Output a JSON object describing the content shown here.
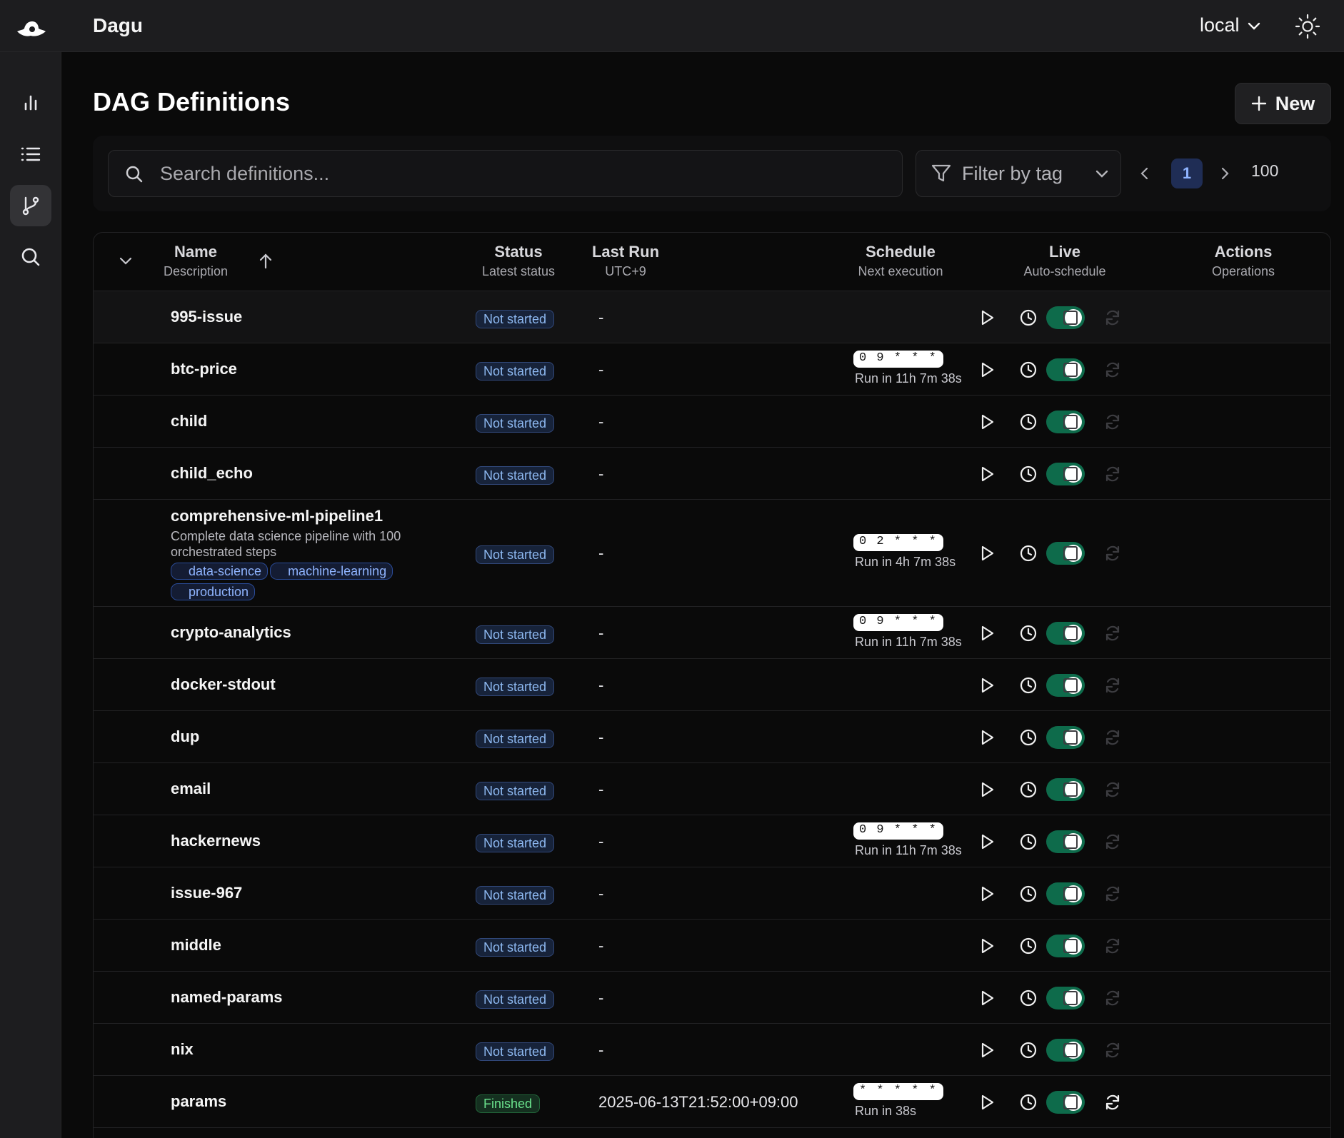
{
  "app": {
    "title": "Dagu",
    "environment": "local"
  },
  "sidebar": {
    "items": [
      {
        "icon": "bar-chart-icon"
      },
      {
        "icon": "list-icon"
      },
      {
        "icon": "git-branch-icon",
        "active": true
      },
      {
        "icon": "search-icon"
      }
    ]
  },
  "page": {
    "title": "DAG Definitions",
    "new_label": "New"
  },
  "filters": {
    "search_placeholder": "Search definitions...",
    "search_value": "",
    "tag_placeholder": "Filter by tag",
    "current_page": "1",
    "page_size": "100"
  },
  "table": {
    "columns": {
      "name": {
        "title": "Name",
        "subtitle": "Description"
      },
      "status": {
        "title": "Status",
        "subtitle": "Latest status"
      },
      "last_run": {
        "title": "Last Run",
        "subtitle": "UTC+9"
      },
      "schedule": {
        "title": "Schedule",
        "subtitle": "Next execution"
      },
      "live": {
        "title": "Live",
        "subtitle": "Auto-schedule"
      },
      "actions": {
        "title": "Actions",
        "subtitle": "Operations"
      }
    },
    "rows": [
      {
        "name": "995-issue",
        "status": "Not started",
        "last_run": "-",
        "live": true
      },
      {
        "name": "btc-price",
        "status": "Not started",
        "last_run": "-",
        "cron": "0 9 * * *",
        "next_run": "Run in 11h 7m 38s",
        "live": true
      },
      {
        "name": "child",
        "status": "Not started",
        "last_run": "-",
        "live": true
      },
      {
        "name": "child_echo",
        "status": "Not started",
        "last_run": "-",
        "live": true
      },
      {
        "name": "comprehensive-ml-pipeline1",
        "description": "Complete data science pipeline with 100 orchestrated steps",
        "tags": [
          "data-science",
          "machine-learning",
          "production"
        ],
        "status": "Not started",
        "last_run": "-",
        "cron": "0 2 * * *",
        "next_run": "Run in 4h 7m 38s",
        "live": true
      },
      {
        "name": "crypto-analytics",
        "status": "Not started",
        "last_run": "-",
        "cron": "0 9 * * *",
        "next_run": "Run in 11h 7m 38s",
        "live": true
      },
      {
        "name": "docker-stdout",
        "status": "Not started",
        "last_run": "-",
        "live": true
      },
      {
        "name": "dup",
        "status": "Not started",
        "last_run": "-",
        "live": true
      },
      {
        "name": "email",
        "status": "Not started",
        "last_run": "-",
        "live": true
      },
      {
        "name": "hackernews",
        "status": "Not started",
        "last_run": "-",
        "cron": "0 9 * * *",
        "next_run": "Run in 11h 7m 38s",
        "live": true
      },
      {
        "name": "issue-967",
        "status": "Not started",
        "last_run": "-",
        "live": true
      },
      {
        "name": "middle",
        "status": "Not started",
        "last_run": "-",
        "live": true
      },
      {
        "name": "named-params",
        "status": "Not started",
        "last_run": "-",
        "live": true
      },
      {
        "name": "nix",
        "status": "Not started",
        "last_run": "-",
        "live": true
      },
      {
        "name": "params",
        "status": "Finished",
        "last_run": "2025-06-13T21:52:00+09:00",
        "cron": "* * * * *",
        "next_run": "Run in 38s",
        "live": true
      }
    ]
  },
  "colors": {
    "accent": "#8fb4ff",
    "toggle_on": "#0e6b4b",
    "status_not_started": "#8db8f0",
    "status_finished": "#6be38d"
  }
}
